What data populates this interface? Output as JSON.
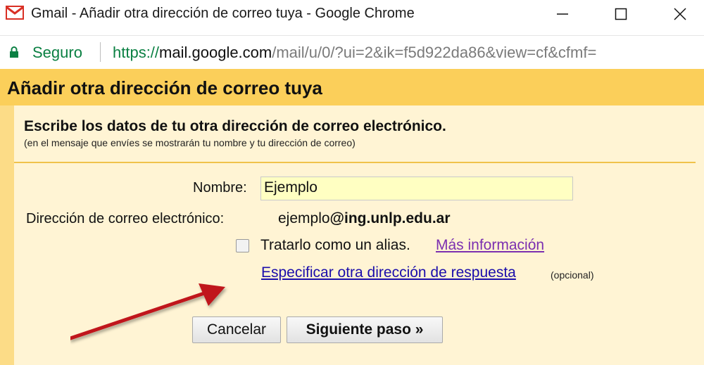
{
  "window": {
    "title": "Gmail - Añadir otra dirección de correo tuya - Google Chrome",
    "controls": {
      "minimize": "—",
      "maximize": "☐",
      "close": "✕"
    }
  },
  "addressbar": {
    "security_label": "Seguro",
    "url_scheme": "https://",
    "url_host": "mail.google.com",
    "url_path": "/mail/u/0/?ui=2&ik=f5d922da86&view=cf&cfmf="
  },
  "dialog": {
    "title": "Añadir otra dirección de correo tuya",
    "heading": "Escribe los datos de tu otra dirección de correo electrónico.",
    "subheading": "(en el mensaje que envíes se mostrarán tu nombre y tu dirección de correo)",
    "name_label": "Nombre:",
    "name_value": "Ejemplo",
    "email_label": "Dirección de correo electrónico:",
    "email_user": "ejemplo",
    "email_domain": "@ing.unlp.edu.ar",
    "alias_checkbox_label": "Tratarlo como un alias.",
    "alias_checked": false,
    "more_info_link": "Más información",
    "reply_to_link": "Especificar otra dirección de respuesta",
    "optional_note": "(opcional)",
    "cancel_button": "Cancelar",
    "next_button": "Siguiente paso »"
  },
  "colors": {
    "header_bg": "#fbcf5a",
    "dialog_bg": "#fcdc87",
    "panel_bg": "#fff4d4",
    "input_bg": "#ffffc2",
    "secure_green": "#0b8043",
    "arrow_red": "#c0141a"
  },
  "icons": {
    "app": "gmail-logo-icon",
    "security": "lock-icon",
    "annotation": "red-arrow-icon"
  }
}
